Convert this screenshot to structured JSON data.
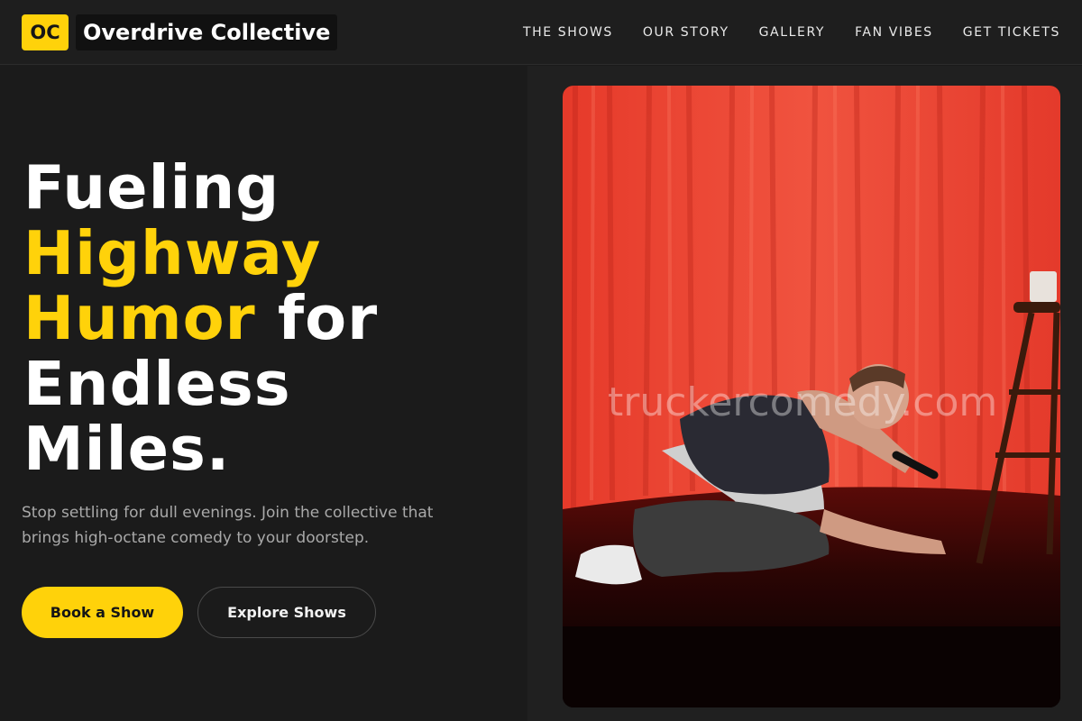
{
  "brand": {
    "logo_text": "OC",
    "name": "Overdrive Collective"
  },
  "nav": {
    "items": [
      "THE SHOWS",
      "OUR STORY",
      "GALLERY",
      "FAN VIBES",
      "GET TICKETS"
    ]
  },
  "hero": {
    "headline_line1": "Fueling",
    "headline_accent1": "Highway",
    "headline_accent2": "Humor",
    "headline_for": "for",
    "headline_line4": "Endless",
    "headline_line5": "Miles.",
    "subtext": "Stop settling for dull evenings. Join the collective that brings high-octane comedy to your doorstep.",
    "primary_button": "Book a Show",
    "secondary_button": "Explore Shows"
  },
  "photo": {
    "watermark": "truckercomedy.com"
  },
  "colors": {
    "accent": "#ffd20a",
    "background": "#1b1b1b",
    "curtain": "#e8412f"
  }
}
